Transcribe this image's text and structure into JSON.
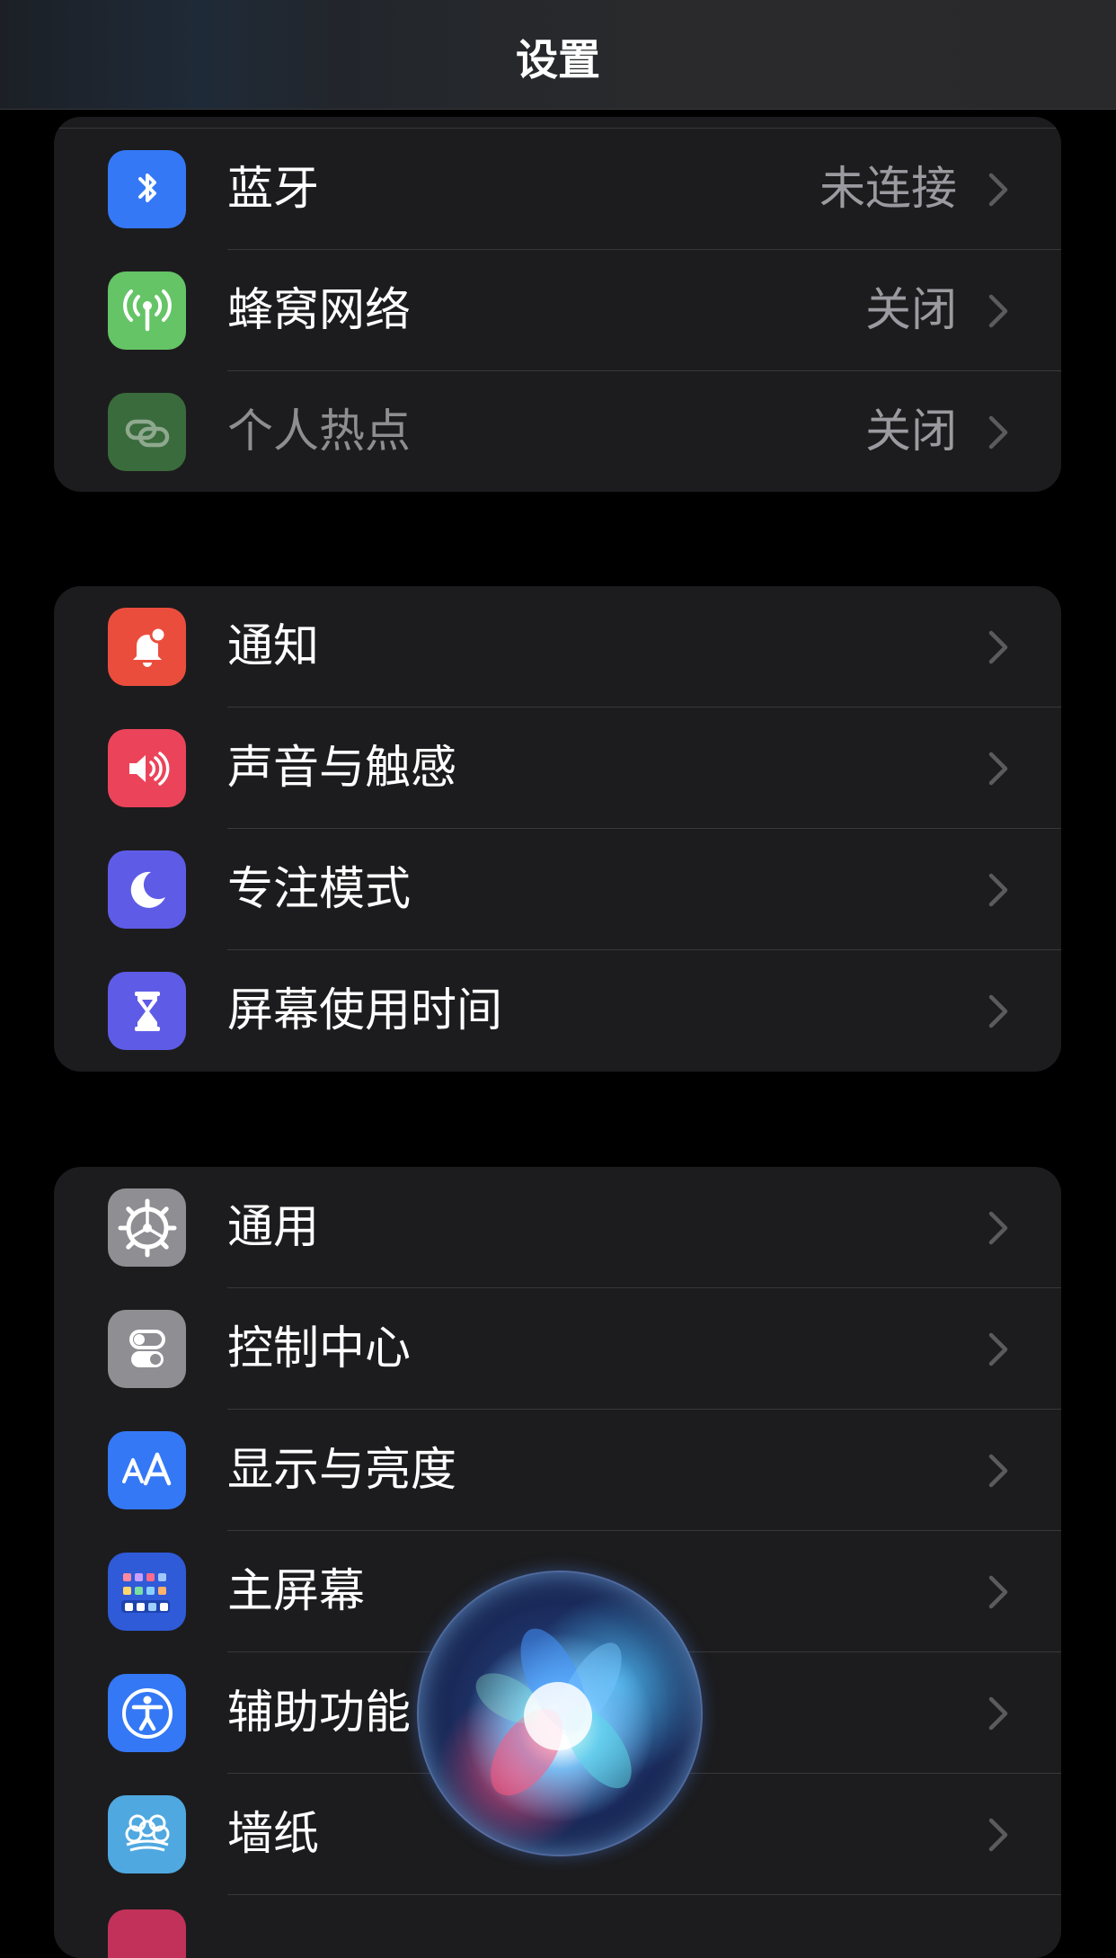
{
  "header": {
    "title": "设置"
  },
  "groups": [
    {
      "items": [
        {
          "label": "蓝牙",
          "value": "未连接",
          "icon": "bluetooth-icon",
          "color": "#3478f6"
        },
        {
          "label": "蜂窝网络",
          "value": "关闭",
          "icon": "cellular-icon",
          "color": "#65c466"
        },
        {
          "label": "个人热点",
          "value": "关闭",
          "icon": "hotspot-icon",
          "color": "#3a6b3c",
          "disabled": true
        }
      ]
    },
    {
      "items": [
        {
          "label": "通知",
          "value": "",
          "icon": "notification-bell-icon",
          "color": "#eb4d3d"
        },
        {
          "label": "声音与触感",
          "value": "",
          "icon": "speaker-icon",
          "color": "#eb445a"
        },
        {
          "label": "专注模式",
          "value": "",
          "icon": "moon-icon",
          "color": "#5e5ce6"
        },
        {
          "label": "屏幕使用时间",
          "value": "",
          "icon": "hourglass-icon",
          "color": "#5e5ce6"
        }
      ]
    },
    {
      "items": [
        {
          "label": "通用",
          "value": "",
          "icon": "gear-icon",
          "color": "#8e8e93"
        },
        {
          "label": "控制中心",
          "value": "",
          "icon": "toggles-icon",
          "color": "#8e8e93"
        },
        {
          "label": "显示与亮度",
          "value": "",
          "icon": "text-size-icon",
          "color": "#3478f6"
        },
        {
          "label": "主屏幕",
          "value": "",
          "icon": "home-screen-grid-icon",
          "color": "#2f5ad8"
        },
        {
          "label": "辅助功能",
          "value": "",
          "icon": "accessibility-icon",
          "color": "#3478f6"
        },
        {
          "label": "墙纸",
          "value": "",
          "icon": "wallpaper-flower-icon",
          "color": "#4fa8e0"
        }
      ]
    }
  ],
  "siri": {
    "icon": "siri-orb-icon"
  }
}
